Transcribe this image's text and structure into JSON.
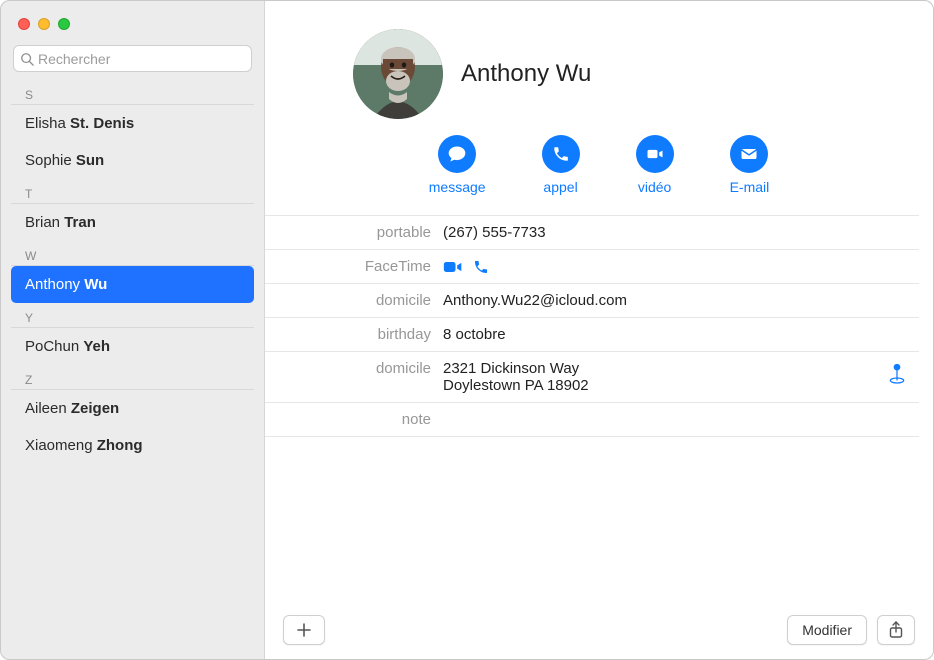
{
  "search": {
    "placeholder": "Rechercher"
  },
  "sidebar": {
    "sections": [
      {
        "letter": "S",
        "contacts": [
          {
            "first": "Elisha",
            "last": "St. Denis"
          },
          {
            "first": "Sophie",
            "last": "Sun"
          }
        ]
      },
      {
        "letter": "T",
        "contacts": [
          {
            "first": "Brian",
            "last": "Tran"
          }
        ]
      },
      {
        "letter": "W",
        "contacts": [
          {
            "first": "Anthony",
            "last": "Wu",
            "selected": true
          }
        ]
      },
      {
        "letter": "Y",
        "contacts": [
          {
            "first": "PoChun",
            "last": "Yeh"
          }
        ]
      },
      {
        "letter": "Z",
        "contacts": [
          {
            "first": "Aileen",
            "last": "Zeigen"
          },
          {
            "first": "Xiaomeng",
            "last": "Zhong"
          }
        ]
      }
    ]
  },
  "detail": {
    "name": "Anthony Wu",
    "actions": {
      "message": "message",
      "call": "appel",
      "video": "vidéo",
      "email": "E-mail"
    },
    "fields": {
      "phone": {
        "label": "portable",
        "value": "(267) 555-7733"
      },
      "facetime": {
        "label": "FaceTime"
      },
      "email": {
        "label": "domicile",
        "value": "Anthony.Wu22@icloud.com"
      },
      "birthday": {
        "label": "birthday",
        "value": "8 octobre"
      },
      "address": {
        "label": "domicile",
        "value": "2321 Dickinson Way\nDoylestown PA 18902"
      },
      "note": {
        "label": "note",
        "value": ""
      }
    }
  },
  "footer": {
    "edit": "Modifier"
  }
}
